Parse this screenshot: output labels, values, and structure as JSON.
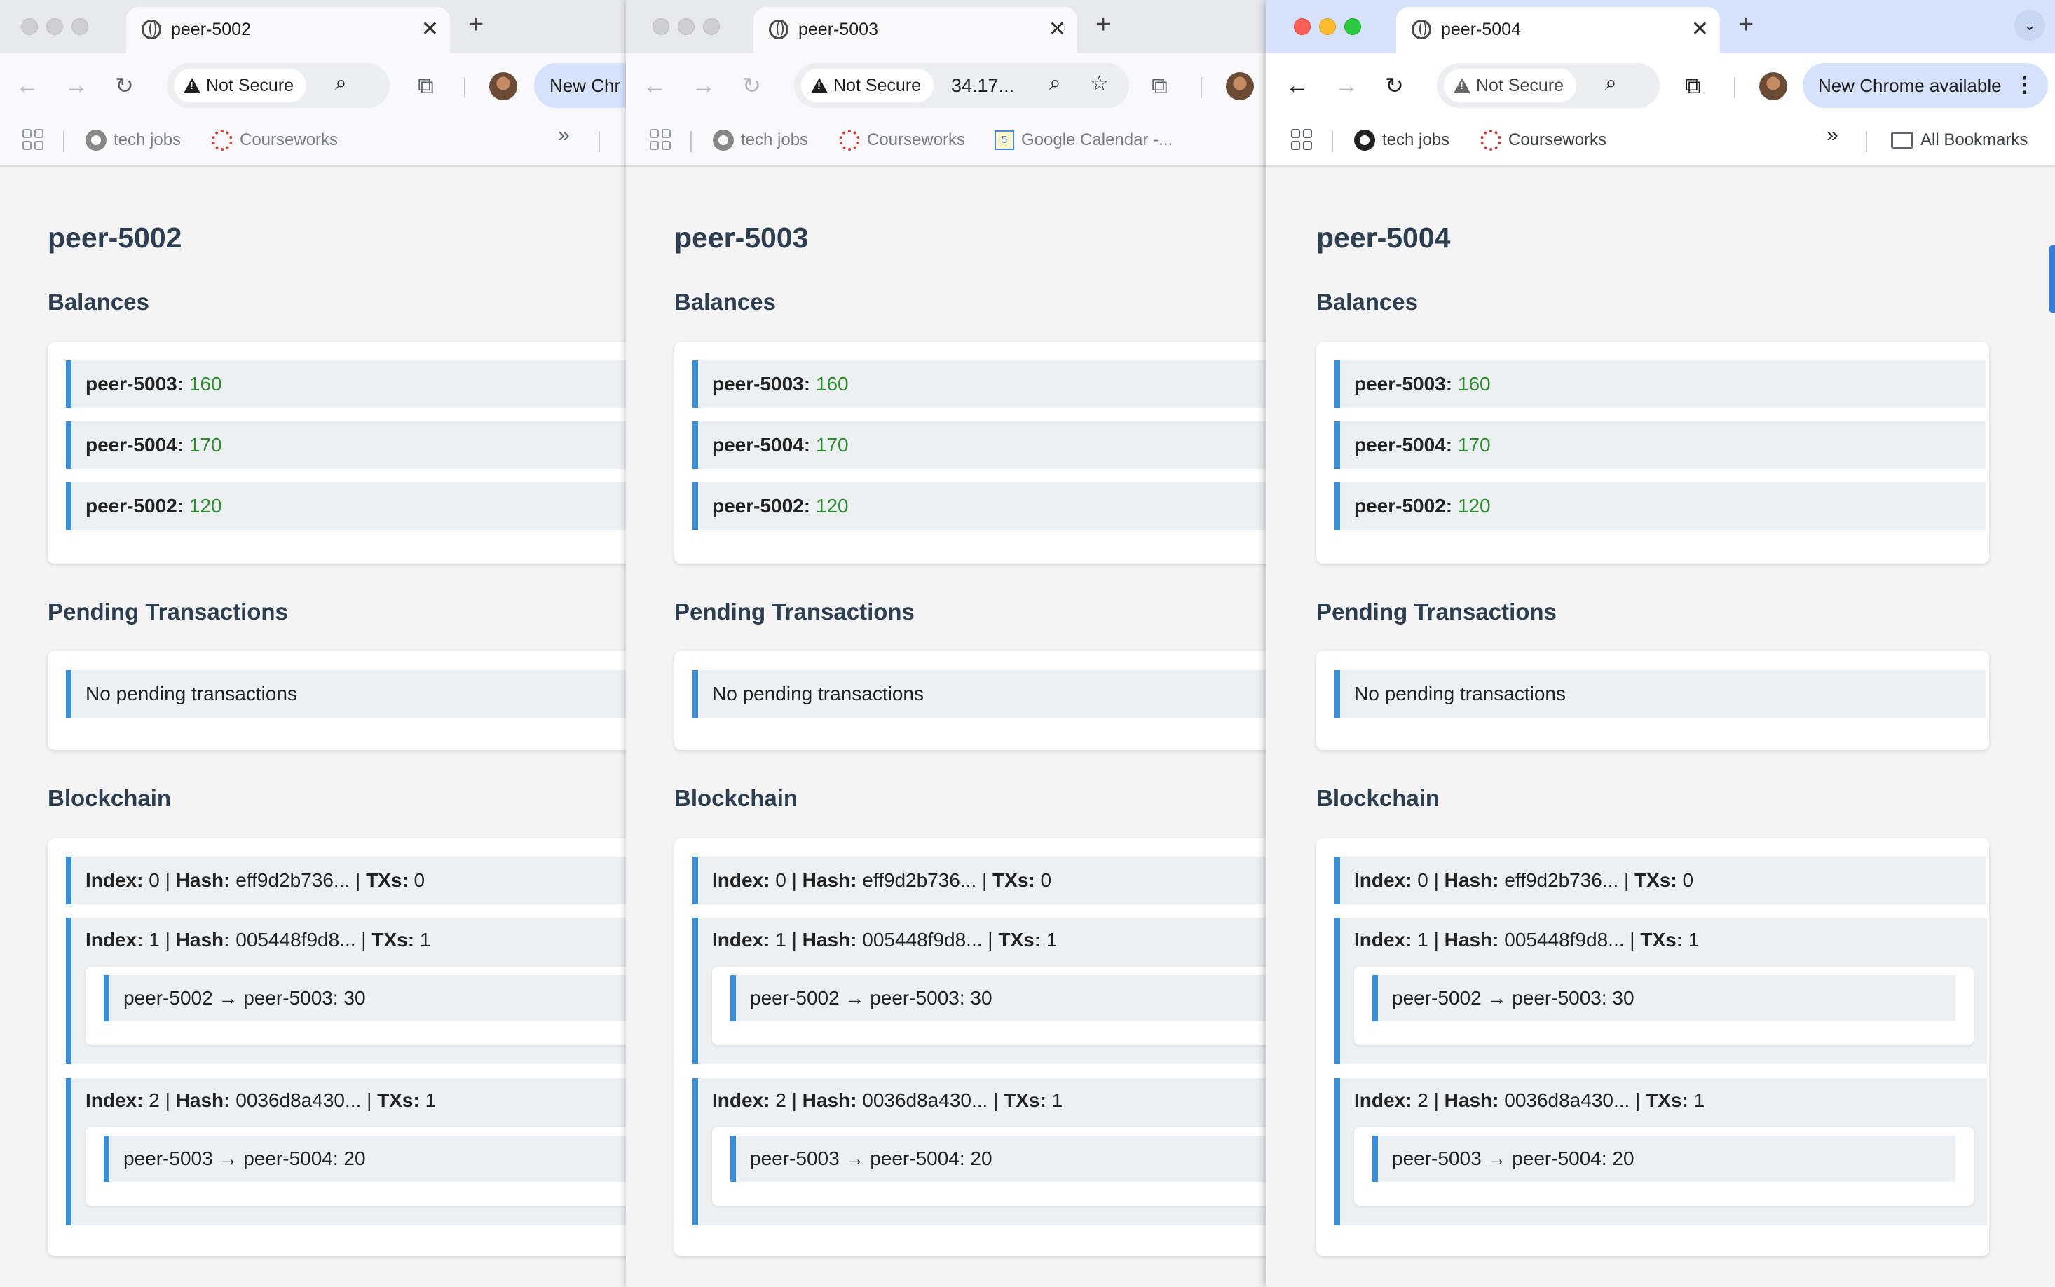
{
  "windows": [
    {
      "tab_title": "peer-5002",
      "secure_label": "Not Secure",
      "url_text": "",
      "update_label": "New Chr",
      "bookmarks": [
        "tech jobs",
        "Courseworks"
      ],
      "page_title": "peer-5002"
    },
    {
      "tab_title": "peer-5003",
      "secure_label": "Not Secure",
      "url_text": "34.17...",
      "update_label": "",
      "bookmarks": [
        "tech jobs",
        "Courseworks",
        "Google Calendar -..."
      ],
      "page_title": "peer-5003"
    },
    {
      "tab_title": "peer-5004",
      "secure_label": "Not Secure",
      "url_text": "",
      "update_label": "New Chrome available",
      "bookmarks": [
        "tech jobs",
        "Courseworks"
      ],
      "all_bookmarks": "All Bookmarks",
      "page_title": "peer-5004"
    }
  ],
  "sections": {
    "balances": "Balances",
    "pending": "Pending Transactions",
    "blockchain": "Blockchain"
  },
  "balances": [
    {
      "peer": "peer-5003:",
      "amount": "160"
    },
    {
      "peer": "peer-5004:",
      "amount": "170"
    },
    {
      "peer": "peer-5002:",
      "amount": "120"
    }
  ],
  "pending_empty": "No pending transactions",
  "labels": {
    "index": "Index:",
    "hash": "Hash:",
    "txs": "TXs:"
  },
  "blocks": [
    {
      "index": "0",
      "hash": "eff9d2b736...",
      "txs": "0",
      "transactions": []
    },
    {
      "index": "1",
      "hash": "005448f9d8...",
      "txs": "1",
      "transactions": [
        "peer-5002 → peer-5003: 30"
      ]
    },
    {
      "index": "2",
      "hash": "0036d8a430...",
      "txs": "1",
      "transactions": [
        "peer-5003 → peer-5004: 20"
      ]
    }
  ],
  "colors": {
    "accent_border": "#3a8fd6",
    "amount_green": "#2e8b2e",
    "heading": "#2c3e50",
    "close_red": "#ff5f57",
    "min_yellow": "#febc2e",
    "max_green": "#28c840"
  },
  "icons": {
    "tab": "globe-icon",
    "back": "arrow-left-icon",
    "forward": "arrow-right-icon",
    "reload": "reload-icon",
    "warning": "warning-triangle-icon",
    "zoom": "magnifier-icon",
    "bookmark_star": "star-icon",
    "extensions": "puzzle-icon",
    "menu": "three-dot-menu-icon"
  }
}
